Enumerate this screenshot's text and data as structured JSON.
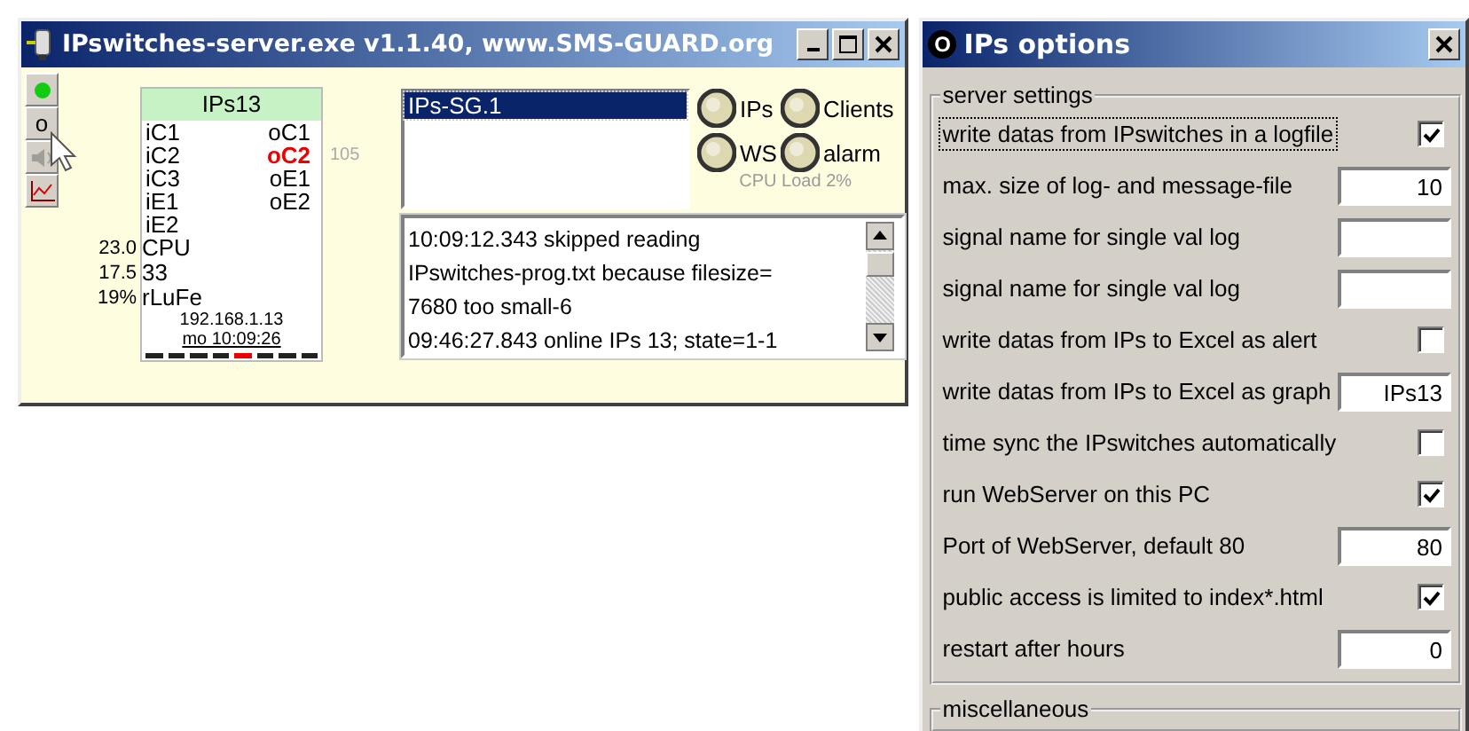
{
  "main_window": {
    "title": "IPswitches-server.exe v1.1.40, www.SMS-GUARD.org",
    "tool_buttons": [
      {
        "kind": "led"
      },
      {
        "kind": "letter",
        "label": "o"
      },
      {
        "kind": "speaker",
        "disabled": true
      },
      {
        "kind": "chart"
      }
    ],
    "device": {
      "name": "IPs13",
      "io_rows": [
        {
          "input": "iC1",
          "output": "oC1",
          "output_active": false
        },
        {
          "input": "iC2",
          "output": "oC2",
          "output_active": true,
          "note": "105"
        },
        {
          "input": "iC3",
          "output": "oE1",
          "output_active": false
        },
        {
          "input": "iE1",
          "output": "oE2",
          "output_active": false
        },
        {
          "input": "iE2"
        }
      ],
      "side_readings": [
        "23.0",
        "17.5",
        "19%"
      ],
      "lower_labels": [
        "CPU",
        "33",
        "rLuFe"
      ],
      "address": "192.168.1.13",
      "time": "mo 10:09:26",
      "segments": [
        {
          "active": false
        },
        {
          "active": false
        },
        {
          "active": false
        },
        {
          "active": false
        },
        {
          "active": true
        },
        {
          "active": false
        },
        {
          "active": false
        },
        {
          "active": false
        }
      ]
    },
    "servers": [
      {
        "label": "IPs-SG.1",
        "selected": true
      }
    ],
    "lamps": [
      {
        "label": "IPs",
        "lit": false
      },
      {
        "label": "Clients",
        "lit": false
      },
      {
        "label": "WS",
        "lit": false
      },
      {
        "label": "alarm",
        "lit": false
      }
    ],
    "cpu_load": "CPU Load 2%",
    "log": [
      "10:09:12.343 skipped reading",
      "IPswitches-prog.txt because filesize=",
      "7680 too small-6",
      "09:46:27.843 online IPs 13; state=1-1"
    ]
  },
  "options_dialog": {
    "title": "IPs options",
    "icon_letter": "O",
    "groups": [
      {
        "title": "server settings",
        "rows": [
          {
            "kind": "checkbox",
            "label": "write datas from IPswitches in a logfile",
            "checked": true
          },
          {
            "kind": "field",
            "label": "max. size of log- and message-file",
            "value": "10"
          },
          {
            "kind": "field",
            "label": "signal name for single val log"
          },
          {
            "kind": "field",
            "label": "signal name for single val log"
          },
          {
            "kind": "checkbox",
            "label": "write datas from IPs  to Excel as alert",
            "checked": false
          },
          {
            "kind": "field",
            "label": "write datas from IPs to Excel as graph",
            "value": "IPs13"
          },
          {
            "kind": "checkbox",
            "label": "time sync the IPswitches automatically",
            "checked": false
          },
          {
            "kind": "checkbox",
            "label": "run WebServer on this PC",
            "checked": true
          },
          {
            "kind": "field",
            "label": "Port of WebServer, default 80",
            "value": "80"
          },
          {
            "kind": "checkbox",
            "label": "public access is limited to index*.html",
            "checked": true
          },
          {
            "kind": "field",
            "label": "restart after hours",
            "value": "0"
          }
        ]
      },
      {
        "title": "miscellaneous"
      }
    ]
  }
}
